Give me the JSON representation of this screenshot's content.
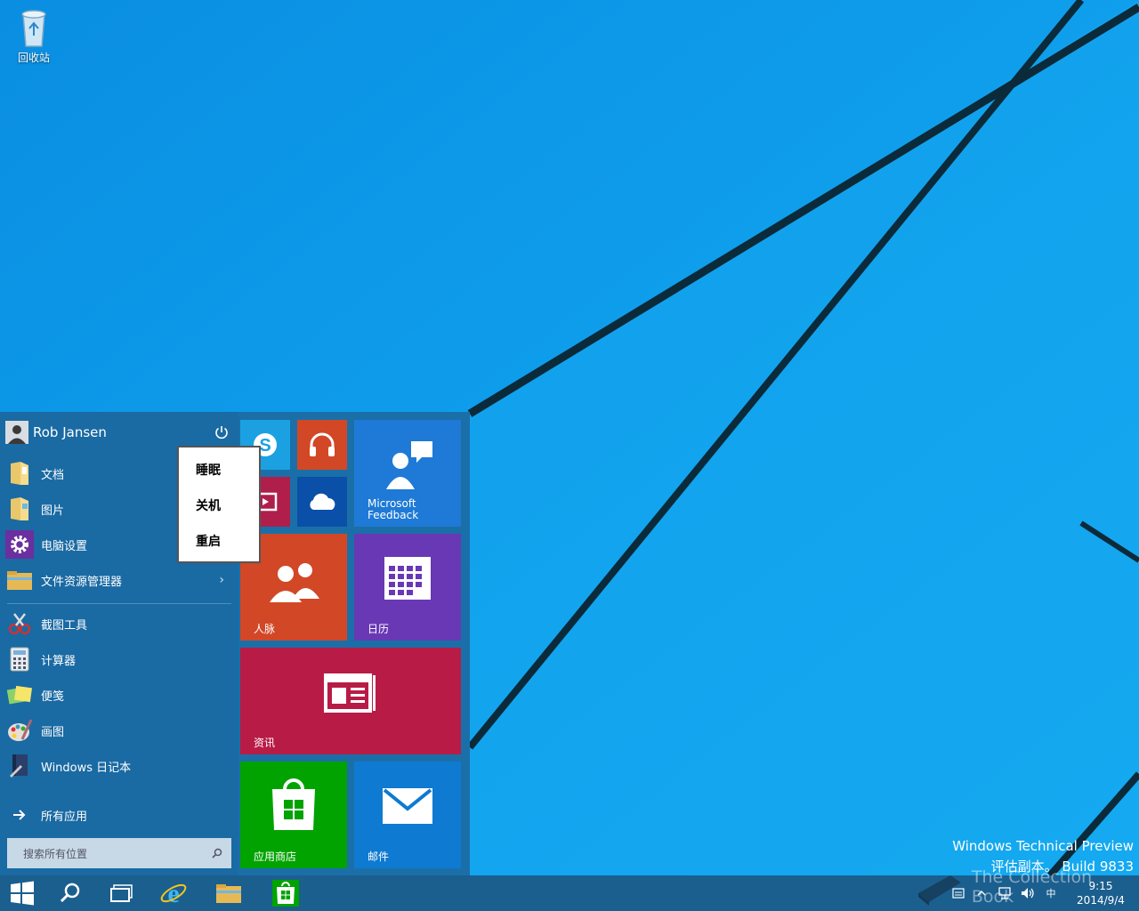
{
  "desktop": {
    "recycle_bin_label": "回收站"
  },
  "start_menu": {
    "user_name": "Rob Jansen",
    "items": [
      {
        "label": "文档",
        "icon": "documents-folder-icon"
      },
      {
        "label": "图片",
        "icon": "pictures-folder-icon"
      },
      {
        "label": "电脑设置",
        "icon": "gear-icon"
      },
      {
        "label": "文件资源管理器",
        "icon": "file-explorer-icon",
        "arrow": "›"
      },
      {
        "label": "截图工具",
        "icon": "snipping-tool-icon"
      },
      {
        "label": "计算器",
        "icon": "calculator-icon"
      },
      {
        "label": "便笺",
        "icon": "sticky-notes-icon"
      },
      {
        "label": "画图",
        "icon": "paint-icon"
      },
      {
        "label": "Windows 日记本",
        "icon": "journal-icon"
      }
    ],
    "all_apps_label": "所有应用",
    "search_placeholder": "搜索所有位置"
  },
  "power_menu": {
    "options": [
      "睡眠",
      "关机",
      "重启"
    ]
  },
  "tiles": {
    "skype": {
      "icon": "skype-icon",
      "color": "#1ba1e2"
    },
    "music": {
      "icon": "headphones-icon",
      "color": "#d24726"
    },
    "video": {
      "icon": "video-icon",
      "color": "#b01e4c"
    },
    "onedrive": {
      "icon": "cloud-icon",
      "color": "#0a4fa8"
    },
    "feedback": {
      "label_line1": "Microsoft",
      "label_line2": "Feedback",
      "icon": "feedback-icon",
      "color": "#1e7ad6"
    },
    "people": {
      "label": "人脉",
      "icon": "people-icon",
      "color": "#d24726"
    },
    "calendar": {
      "label": "日历",
      "icon": "calendar-icon",
      "color": "#6838b5"
    },
    "news": {
      "label": "资讯",
      "icon": "news-icon",
      "color": "#b81c46"
    },
    "store": {
      "label": "应用商店",
      "icon": "store-icon",
      "color": "#00a300"
    },
    "mail": {
      "label": "邮件",
      "icon": "mail-icon",
      "color": "#0e7ad1"
    }
  },
  "watermark": {
    "line1": "Windows Technical Preview",
    "line2": "评估副本。 Build 9833"
  },
  "overlay_text": "The Collection Book",
  "taskbar": {
    "items": [
      "start-icon",
      "search-icon",
      "task-view-icon",
      "internet-explorer-icon",
      "file-explorer-icon",
      "store-icon"
    ],
    "tray": {
      "ime": "中",
      "time": "9:15",
      "date": "2014/9/4"
    }
  }
}
